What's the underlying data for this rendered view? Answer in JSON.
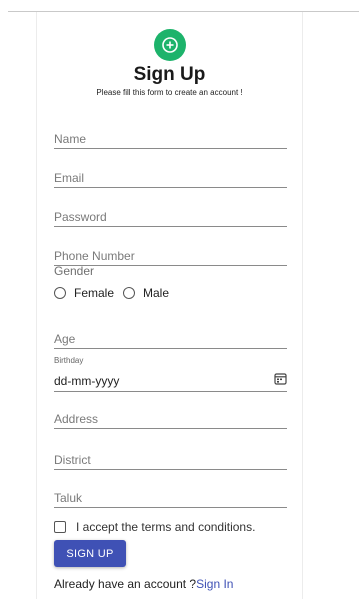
{
  "header": {
    "title": "Sign Up",
    "subtitle": "Please fill this form to create an account !",
    "avatar_icon": "add-circle-icon",
    "avatar_color": "#1db36b"
  },
  "form": {
    "name_placeholder": "Name",
    "email_placeholder": "Email",
    "password_placeholder": "Password",
    "phone_placeholder": "Phone Number",
    "gender_label": "Gender",
    "gender_options": [
      "Female",
      "Male"
    ],
    "age_placeholder": "Age",
    "birthday_label": "Birthday",
    "birthday_value": "dd-mm-yyyy",
    "address_placeholder": "Address",
    "district_placeholder": "District",
    "taluk_placeholder": "Taluk",
    "terms_label": "I accept the terms and conditions."
  },
  "actions": {
    "signup_label": "SIGN UP",
    "signup_color": "#3f51b5",
    "signin_prompt": "Already have an account ?",
    "signin_link": "Sign In"
  }
}
